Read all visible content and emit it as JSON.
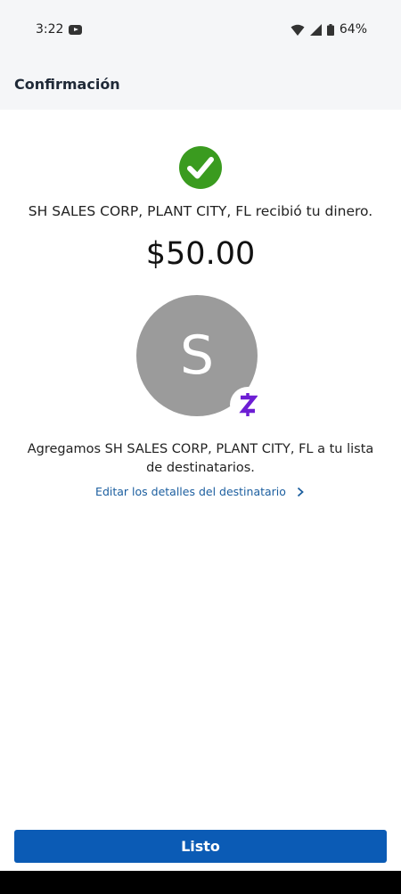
{
  "status_bar": {
    "time": "3:22",
    "battery": "64%"
  },
  "header": {
    "title": "Confirmación"
  },
  "confirmation": {
    "message": "SH SALES CORP, PLANT CITY, FL recibió tu dinero.",
    "amount": "$50.00",
    "avatar_letter": "S",
    "added_text": "Agregamos SH SALES CORP, PLANT CITY, FL a tu lista de destinatarios.",
    "edit_link": "Editar los detalles del destinatario"
  },
  "actions": {
    "done_label": "Listo"
  },
  "colors": {
    "success": "#3a9b1f",
    "zelle": "#6d1ed4",
    "primary": "#0b5bb5",
    "link": "#1b5e9f"
  }
}
